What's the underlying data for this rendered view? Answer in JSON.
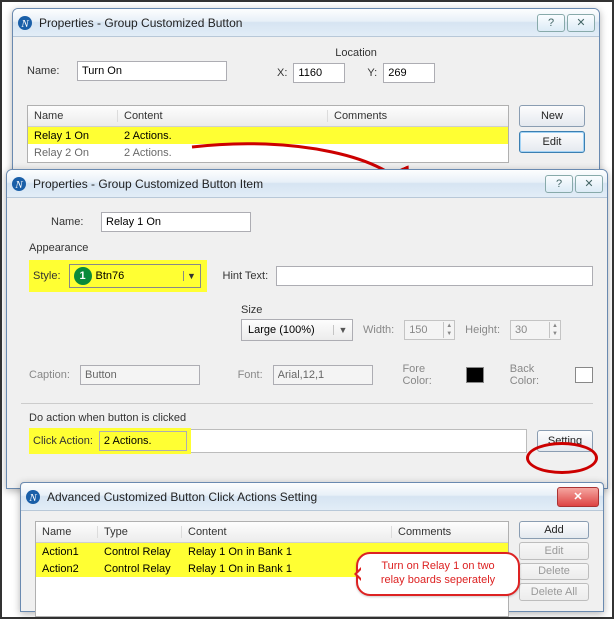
{
  "win1": {
    "title": "Properties - Group Customized Button",
    "name_label": "Name:",
    "name_value": "Turn On",
    "location_label": "Location",
    "x_label": "X:",
    "x_value": "1160",
    "y_label": "Y:",
    "y_value": "269",
    "table": {
      "headers": {
        "name": "Name",
        "content": "Content",
        "comments": "Comments"
      },
      "rows": [
        {
          "name": "Relay 1 On",
          "content": "2 Actions."
        },
        {
          "name": "Relay 2 On",
          "content": "2 Actions."
        }
      ]
    },
    "buttons": {
      "new": "New",
      "edit": "Edit"
    },
    "help": "?",
    "close": "✕"
  },
  "win2": {
    "title": "Properties - Group Customized Button Item",
    "name_label": "Name:",
    "name_value": "Relay 1 On",
    "appearance_label": "Appearance",
    "style_label": "Style:",
    "style_badge": "1",
    "style_value": "Btn76",
    "hint_label": "Hint Text:",
    "hint_value": "",
    "size_label": "Size",
    "size_value": "Large     (100%)",
    "width_label": "Width:",
    "width_value": "150",
    "height_label": "Height:",
    "height_value": "30",
    "caption_label": "Caption:",
    "caption_value": "Button",
    "font_label": "Font:",
    "font_value": "Arial,12,1",
    "fore_label": "Fore Color:",
    "back_label": "Back Color:",
    "do_action_label": "Do action when button is clicked",
    "click_action_label": "Click Action:",
    "click_action_value": "2 Actions.",
    "setting_btn": "Setting",
    "help": "?",
    "close": "✕"
  },
  "win3": {
    "title": "Advanced Customized Button Click Actions Setting",
    "table": {
      "headers": {
        "name": "Name",
        "type": "Type",
        "content": "Content",
        "comments": "Comments"
      },
      "rows": [
        {
          "name": "Action1",
          "type": "Control Relay",
          "content": "Relay 1 On in Bank 1"
        },
        {
          "name": "Action2",
          "type": "Control Relay",
          "content": "Relay 1 On in Bank 1"
        }
      ]
    },
    "buttons": {
      "add": "Add",
      "edit": "Edit",
      "delete": "Delete",
      "delete_all": "Delete All"
    },
    "close": "✕"
  },
  "annot": {
    "speech": "Turn on Relay 1 on two\nrelay boards seperately"
  }
}
